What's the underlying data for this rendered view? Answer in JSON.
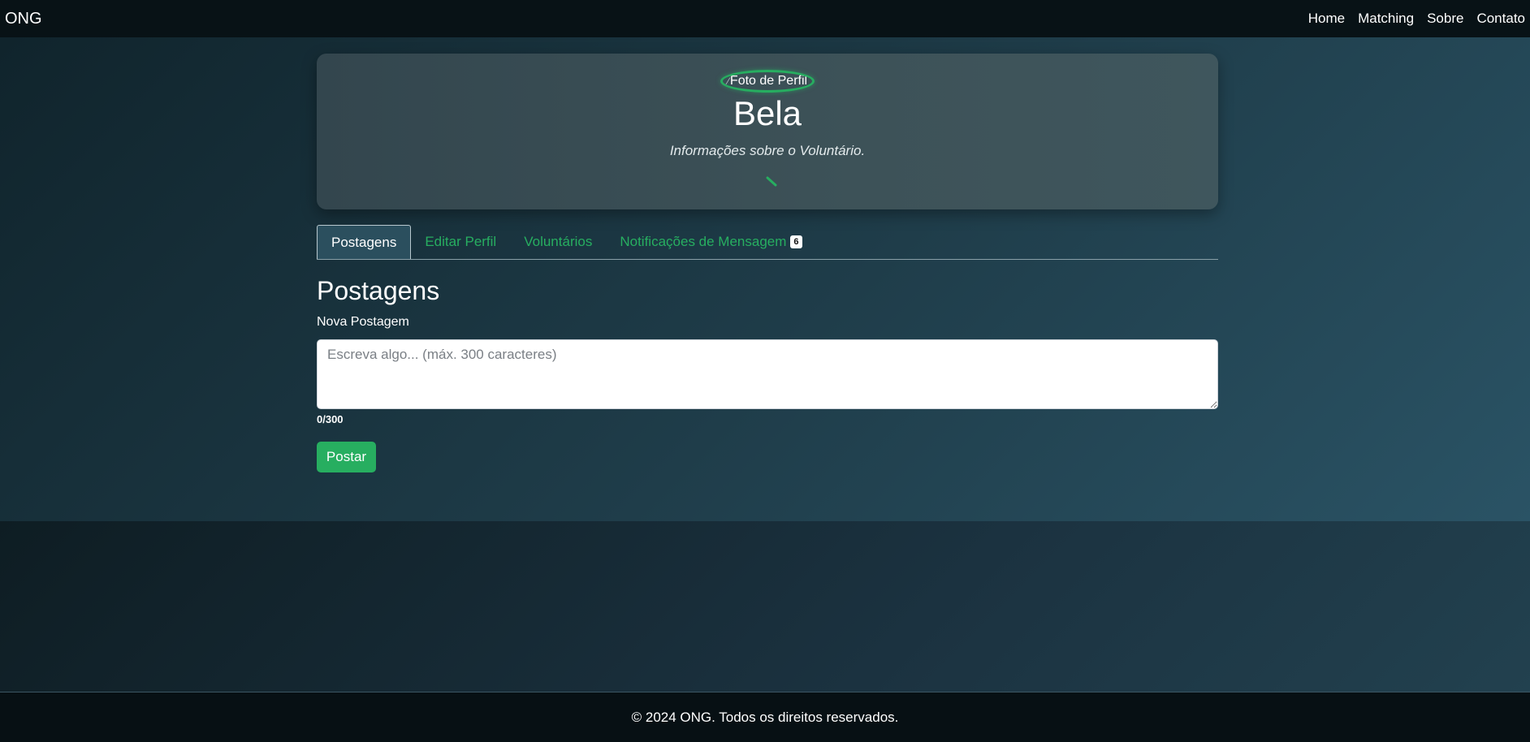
{
  "navbar": {
    "brand": "ONG",
    "links": [
      "Home",
      "Matching",
      "Sobre",
      "Contato"
    ]
  },
  "profile": {
    "avatar_alt": "Foto de Perfil",
    "name": "Bela",
    "info": "Informações sobre o Voluntário.",
    "edit_icon": "pencil-icon"
  },
  "tabs": [
    {
      "label": "Postagens",
      "active": true
    },
    {
      "label": "Editar Perfil",
      "active": false
    },
    {
      "label": "Voluntários",
      "active": false
    },
    {
      "label": "Notificações de Mensagem",
      "active": false,
      "badge": "6"
    }
  ],
  "posts": {
    "title": "Postagens",
    "new_post_label": "Nova Postagem",
    "textarea_placeholder": "Escreva algo... (máx. 300 caracteres)",
    "textarea_value": "",
    "char_count": "0/300",
    "submit_label": "Postar"
  },
  "footer": {
    "text": "© 2024 ONG. Todos os direitos reservados."
  },
  "colors": {
    "accent": "#27ae60",
    "navbar_bg": "#081216",
    "active_tab_bg": "#2b4f5e"
  }
}
